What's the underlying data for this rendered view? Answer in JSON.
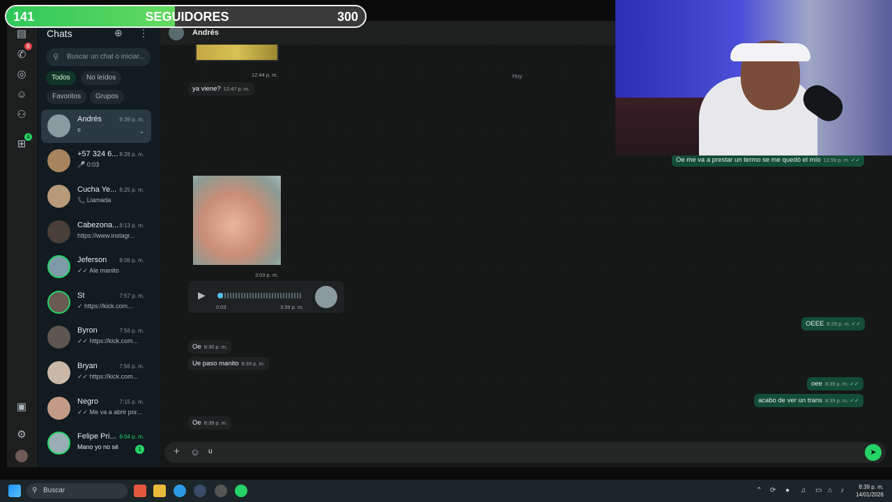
{
  "overlay": {
    "followers_current": "141",
    "followers_label": "SEGUIDORES",
    "followers_goal": "300",
    "progress_fraction": 0.47
  },
  "rail": {
    "calls_badge": "6",
    "communities_badge": "4"
  },
  "sidebar": {
    "title": "Chats",
    "search_placeholder": "Buscar un chat o iniciar...",
    "filters": [
      "Todos",
      "No leídos",
      "Favoritos",
      "Grupos"
    ],
    "chats": [
      {
        "name": "Andrés",
        "time": "8:39 p. m.",
        "preview": "e"
      },
      {
        "name": "+57 324 6...",
        "time": "8:28 p. m.",
        "preview": "🎤 0:03"
      },
      {
        "name": "Cucha Ye...",
        "time": "8:25 p. m.",
        "preview": "📞 Llamada"
      },
      {
        "name": "Cabezona...",
        "time": "8:13 p. m.",
        "preview": "https://www.instagr..."
      },
      {
        "name": "Jeferson",
        "time": "8:06 p. m.",
        "preview": "✓✓ Ale manito"
      },
      {
        "name": "St",
        "time": "7:57 p. m.",
        "preview": "✓ https://kick.com..."
      },
      {
        "name": "Byron",
        "time": "7:56 p. m.",
        "preview": "✓✓ https://kick.com..."
      },
      {
        "name": "Bryan",
        "time": "7:56 p. m.",
        "preview": "✓✓ https://kick.com..."
      },
      {
        "name": "Negro",
        "time": "7:15 p. m.",
        "preview": "✓✓ Me va a abrir por..."
      },
      {
        "name": "Felipe Pri...",
        "time": "6:04 p. m.",
        "preview": "Mano yo no sé",
        "unread": "1"
      }
    ]
  },
  "conversation": {
    "contact_name": "Andrés",
    "day_label": "Hoy",
    "photo1_time": "12:44 p. m.",
    "msg_yaviene": {
      "text": "ya viene?",
      "time": "12:47 p. m."
    },
    "msg_termo": {
      "text": "Oe me va a prestar un termo se me quedó el mío",
      "time": "12:59 p. m."
    },
    "photo2_time": "3:03 p. m.",
    "voice": {
      "duration": "0:03",
      "time": "3:39 p. m."
    },
    "msg_oeee": {
      "text": "OEEE",
      "time": "8:29 p. m."
    },
    "msg_oe1": {
      "text": "Oe",
      "time": "8:30 p. m."
    },
    "msg_uepaso": {
      "text": "Ue paso manito",
      "time": "8:39 p. m."
    },
    "msg_oee": {
      "text": "oee",
      "time": "8:39 p. m."
    },
    "msg_acabo": {
      "text": "acabo de ver un trans",
      "time": "8:39 p. m."
    },
    "msg_oe2": {
      "text": "Oe",
      "time": "8:39 p. m."
    },
    "composer_value": "u"
  },
  "taskbar": {
    "search_label": "Buscar",
    "time": "8:39 p. m.",
    "date": "14/01/2026"
  }
}
